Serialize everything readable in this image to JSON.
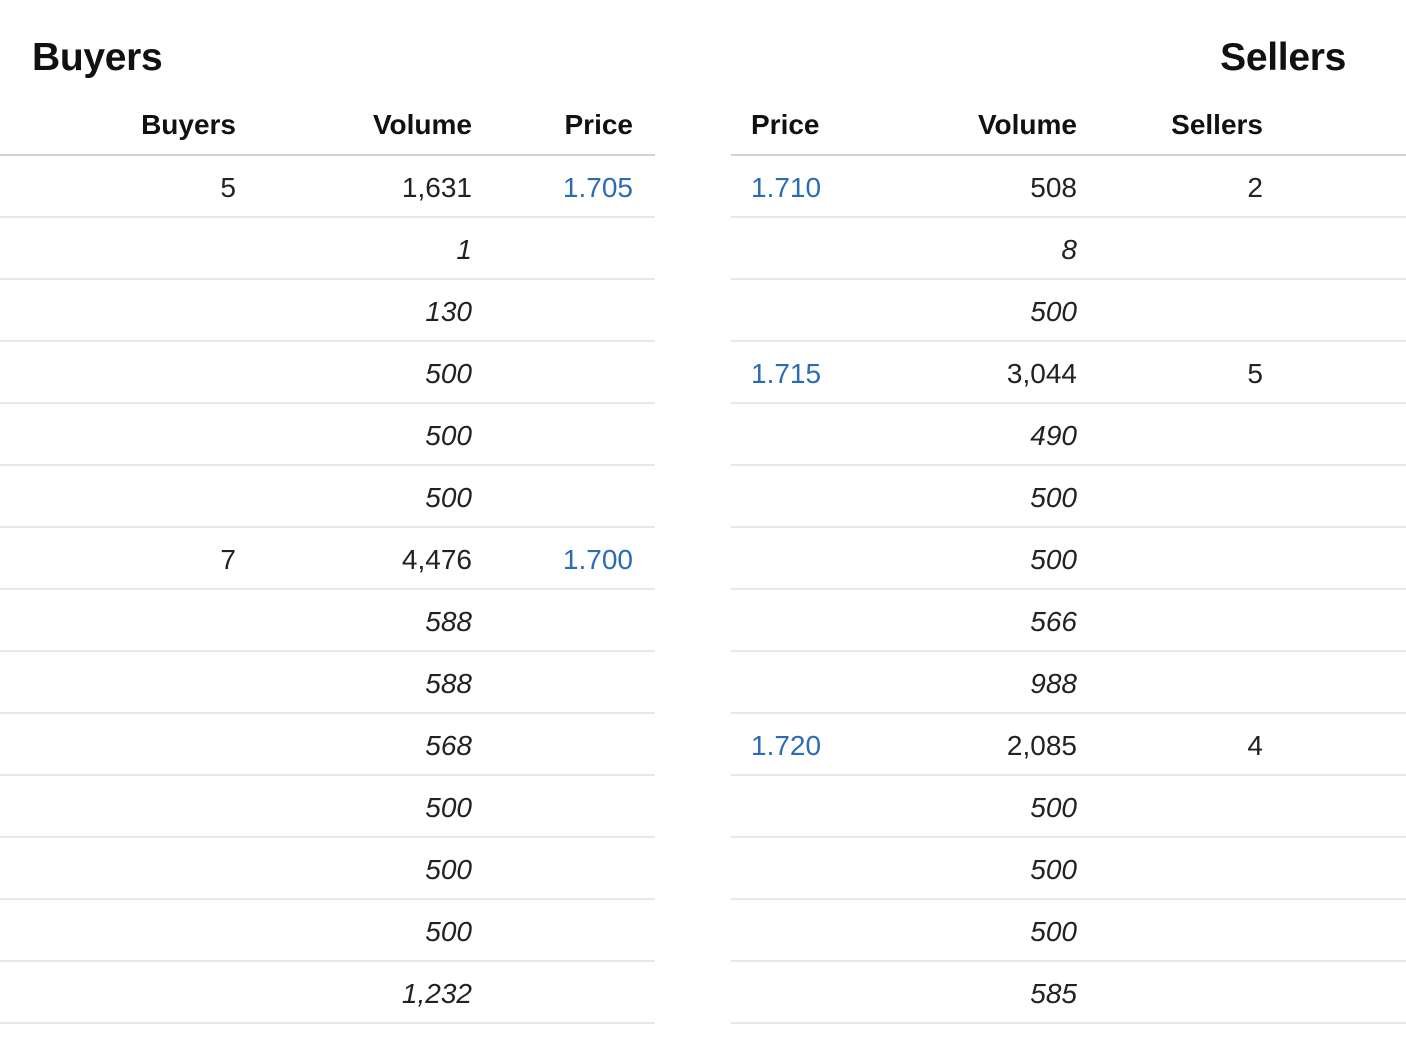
{
  "buyers": {
    "title": "Buyers",
    "headers": {
      "count": "Buyers",
      "volume": "Volume",
      "price": "Price"
    },
    "rows": [
      {
        "count": "5",
        "volume": "1,631",
        "price": "1.705",
        "sub": false
      },
      {
        "count": "",
        "volume": "1",
        "price": "",
        "sub": true
      },
      {
        "count": "",
        "volume": "130",
        "price": "",
        "sub": true
      },
      {
        "count": "",
        "volume": "500",
        "price": "",
        "sub": true
      },
      {
        "count": "",
        "volume": "500",
        "price": "",
        "sub": true
      },
      {
        "count": "",
        "volume": "500",
        "price": "",
        "sub": true
      },
      {
        "count": "7",
        "volume": "4,476",
        "price": "1.700",
        "sub": false
      },
      {
        "count": "",
        "volume": "588",
        "price": "",
        "sub": true
      },
      {
        "count": "",
        "volume": "588",
        "price": "",
        "sub": true
      },
      {
        "count": "",
        "volume": "568",
        "price": "",
        "sub": true
      },
      {
        "count": "",
        "volume": "500",
        "price": "",
        "sub": true
      },
      {
        "count": "",
        "volume": "500",
        "price": "",
        "sub": true
      },
      {
        "count": "",
        "volume": "500",
        "price": "",
        "sub": true
      },
      {
        "count": "",
        "volume": "1,232",
        "price": "",
        "sub": true
      }
    ]
  },
  "sellers": {
    "title": "Sellers",
    "headers": {
      "price": "Price",
      "volume": "Volume",
      "count": "Sellers"
    },
    "rows": [
      {
        "price": "1.710",
        "volume": "508",
        "count": "2",
        "sub": false
      },
      {
        "price": "",
        "volume": "8",
        "count": "",
        "sub": true
      },
      {
        "price": "",
        "volume": "500",
        "count": "",
        "sub": true
      },
      {
        "price": "1.715",
        "volume": "3,044",
        "count": "5",
        "sub": false
      },
      {
        "price": "",
        "volume": "490",
        "count": "",
        "sub": true
      },
      {
        "price": "",
        "volume": "500",
        "count": "",
        "sub": true
      },
      {
        "price": "",
        "volume": "500",
        "count": "",
        "sub": true
      },
      {
        "price": "",
        "volume": "566",
        "count": "",
        "sub": true
      },
      {
        "price": "",
        "volume": "988",
        "count": "",
        "sub": true
      },
      {
        "price": "1.720",
        "volume": "2,085",
        "count": "4",
        "sub": false
      },
      {
        "price": "",
        "volume": "500",
        "count": "",
        "sub": true
      },
      {
        "price": "",
        "volume": "500",
        "count": "",
        "sub": true
      },
      {
        "price": "",
        "volume": "500",
        "count": "",
        "sub": true
      },
      {
        "price": "",
        "volume": "585",
        "count": "",
        "sub": true
      }
    ]
  },
  "colors": {
    "price_link": "#2b6cb8",
    "header_rule": "#cfd3d9",
    "row_rule": "#e6e8ec"
  }
}
